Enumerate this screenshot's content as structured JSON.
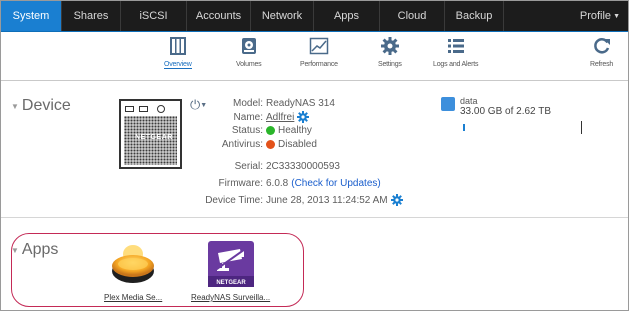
{
  "nav": {
    "tabs": [
      {
        "label": "System"
      },
      {
        "label": "Shares"
      },
      {
        "label": "iSCSI"
      },
      {
        "label": "Accounts"
      },
      {
        "label": "Network"
      },
      {
        "label": "Apps"
      },
      {
        "label": "Cloud"
      },
      {
        "label": "Backup"
      },
      {
        "label": "Profile"
      }
    ],
    "active": "System",
    "active_color": "#1a7fd1"
  },
  "toolbar": {
    "items": [
      {
        "label": "Overview",
        "icon": "overview-icon"
      },
      {
        "label": "Volumes",
        "icon": "volumes-icon"
      },
      {
        "label": "Performance",
        "icon": "performance-icon"
      },
      {
        "label": "Settings",
        "icon": "settings-gear-icon"
      },
      {
        "label": "Logs and Alerts",
        "icon": "logs-list-icon"
      },
      {
        "label": "Refresh",
        "icon": "refresh-icon"
      }
    ]
  },
  "device": {
    "section_title": "Device",
    "brand": "NETGEAR",
    "model_key": "Model:",
    "model_value": "ReadyNAS 314",
    "name_key": "Name:",
    "name_value": "Adlfrei",
    "status_key": "Status:",
    "status_value": "Healthy",
    "status_color": "#2ab52a",
    "antivirus_key": "Antivirus:",
    "antivirus_value": "Disabled",
    "antivirus_color": "#e3521a",
    "serial_key": "Serial:",
    "serial_value": "2C33330000593",
    "firmware_key": "Firmware:",
    "firmware_value": "6.0.8",
    "firmware_link": "(Check for Updates)",
    "time_key": "Device Time:",
    "time_value": "June 28, 2013 11:24:52 AM"
  },
  "volume": {
    "name": "data",
    "size": "33.00 GB of 2.62 TB",
    "usage_fraction": 0.012
  },
  "apps": {
    "section_title": "Apps",
    "items": [
      {
        "label": "Plex Media Se...",
        "icon": "plex-icon"
      },
      {
        "label": "ReadyNAS Surveilla...",
        "icon": "surveillance-camera-icon"
      }
    ]
  }
}
